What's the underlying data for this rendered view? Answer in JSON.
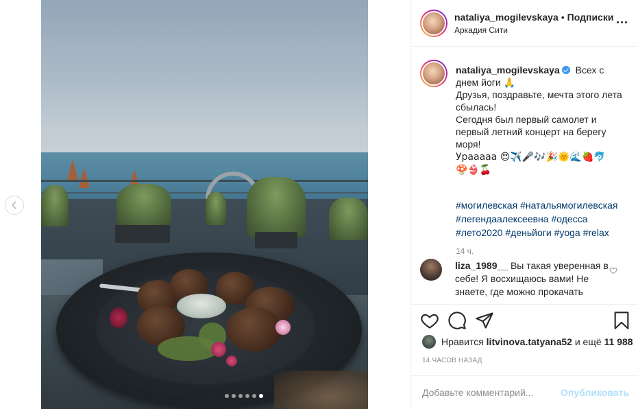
{
  "post": {
    "carousel": {
      "count": 6,
      "active_index": 5
    },
    "header": {
      "username": "nataliya_mogilevskaya",
      "separator": "•",
      "follow_label": "Подписки",
      "location": "Аркадия Сити"
    },
    "caption": {
      "username": "nataliya_mogilevskaya",
      "lines": [
        "Всех с днем йоги 🙏",
        "Друзья, поздравьте, мечта этого лета сбылась!",
        "Сегодня был первый самолет и первый летний концерт на берегу моря!",
        "Урааааа 😍✈️🎤🎶🎉🌞🌊🍓🐬",
        "🍄👙🍒"
      ],
      "hashtags": [
        "#могилевская",
        "#натальямогилевская",
        "#легендаалексеевна",
        "#одесса",
        "#лето2020",
        "#деньйоги",
        "#yoga",
        "#relax"
      ],
      "time": "14 ч."
    },
    "comments": [
      {
        "username": "liza_1989__",
        "text": "Вы такая уверенная в себе! Я восхищаюсь вами! Не знаете, где можно прокачать"
      }
    ],
    "likes": {
      "prefix": "Нравится",
      "user": "litvinova.tatyana52",
      "middle": "и ещё",
      "count": "11 988"
    },
    "time_ago": "14 часов назад",
    "comment_input": {
      "placeholder": "Добавьте комментарий...",
      "publish_label": "Опубликовать"
    }
  },
  "icons": {
    "heart": "heart-icon",
    "comment": "comment-icon",
    "share": "share-icon",
    "bookmark": "bookmark-icon",
    "more": "more-icon",
    "prev": "chevron-left-icon",
    "verified": "verified-badge-icon"
  },
  "colors": {
    "link": "#00376b",
    "verified": "#3897f0",
    "muted": "#8e8e8e",
    "publish_disabled": "#b2dffc"
  }
}
